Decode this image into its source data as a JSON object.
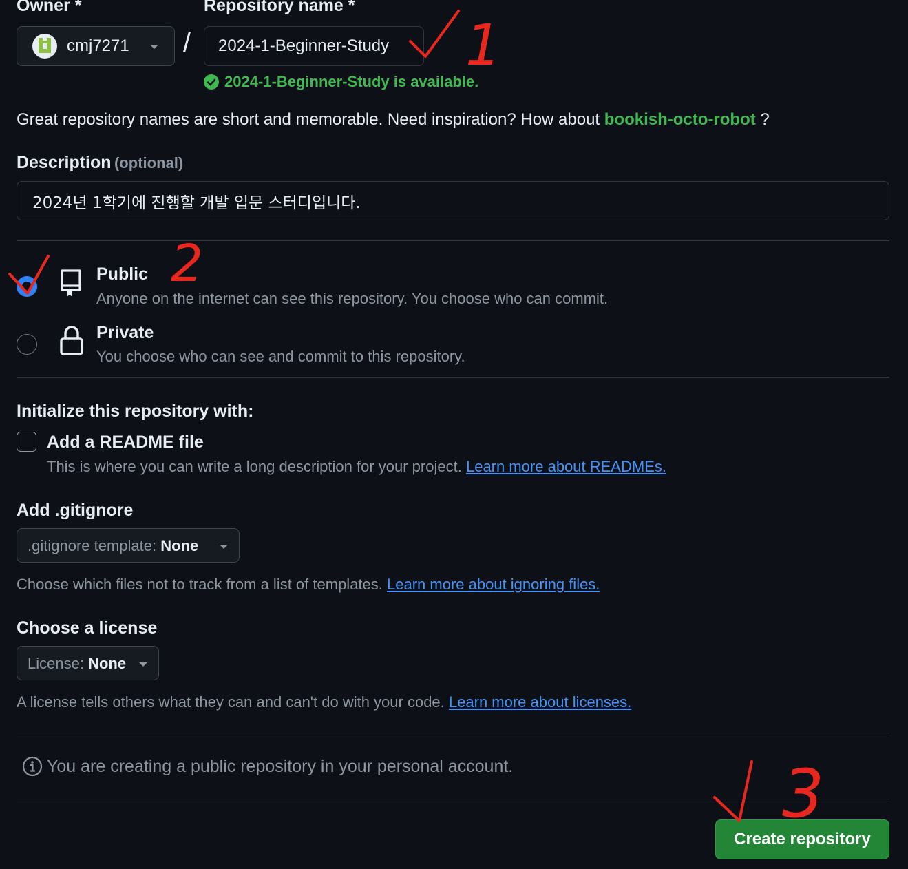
{
  "owner": {
    "label": "Owner *",
    "username": "cmj7271"
  },
  "repo_name": {
    "label": "Repository name *",
    "value": "2024-1-Beginner-Study",
    "separator": "/",
    "availability": "2024-1-Beginner-Study is available."
  },
  "inspiration": {
    "text": "Great repository names are short and memorable. Need inspiration? How about",
    "suggestion": "bookish-octo-robot",
    "suffix": "?"
  },
  "description": {
    "label": "Description",
    "optional": "(optional)",
    "value": "2024년 1학기에 진행할 개발 입문 스터디입니다."
  },
  "visibility": {
    "public": {
      "title": "Public",
      "desc": "Anyone on the internet can see this repository. You choose who can commit.",
      "selected": true
    },
    "private": {
      "title": "Private",
      "desc": "You choose who can see and commit to this repository.",
      "selected": false
    }
  },
  "init": {
    "heading": "Initialize this repository with:",
    "readme_label": "Add a README file",
    "readme_desc": "This is where you can write a long description for your project.",
    "readme_link": "Learn more about READMEs.",
    "readme_checked": false
  },
  "gitignore": {
    "heading": "Add .gitignore",
    "select_prefix": ".gitignore template:",
    "select_value": "None",
    "desc": "Choose which files not to track from a list of templates.",
    "link": "Learn more about ignoring files."
  },
  "license": {
    "heading": "Choose a license",
    "select_prefix": "License:",
    "select_value": "None",
    "desc": "A license tells others what they can and can't do with your code.",
    "link": "Learn more about licenses."
  },
  "notice": {
    "text": "You are creating a public repository in your personal account.",
    "icon": "info-icon"
  },
  "submit": {
    "label": "Create repository"
  },
  "annotations": {
    "marks": [
      "1",
      "2",
      "3"
    ],
    "color": "#e8281e"
  },
  "colors": {
    "background": "#0d1117",
    "success": "#3fb950",
    "link": "#4493f8",
    "primary_button": "#238636",
    "radio_selected": "#2f81f7"
  }
}
